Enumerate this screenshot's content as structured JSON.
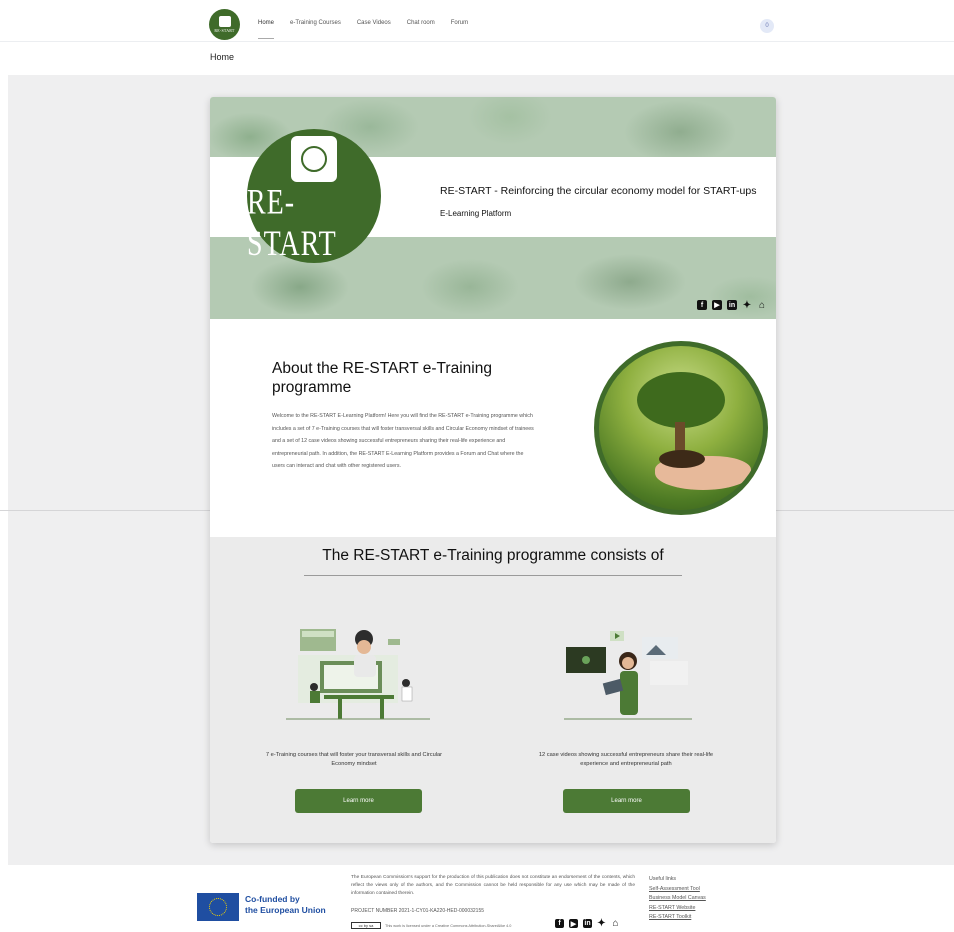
{
  "nav": {
    "brand_small": "RE-START",
    "items": [
      {
        "label": "Home",
        "active": true
      },
      {
        "label": "e-Training Courses",
        "active": false
      },
      {
        "label": "Case Videos",
        "active": false
      },
      {
        "label": "Chat room",
        "active": false
      },
      {
        "label": "Forum",
        "active": false
      }
    ],
    "user_initial": "0"
  },
  "breadcrumb": "Home",
  "hero": {
    "brand": "RE-START",
    "title": "RE-START - Reinforcing the circular economy model for START-ups",
    "subtitle": "E-Learning Platform",
    "socials": [
      "facebook-icon",
      "youtube-icon",
      "linkedin-icon",
      "twitter-icon",
      "home-icon"
    ]
  },
  "about": {
    "title": "About the RE-START e-Training programme",
    "text": "Welcome to the RE-START E-Learning Platform! Here you will find the RE-START e-Training programme which includes a set of 7 e-Training courses that will foster transversal skills and Circular Economy mindset of trainees and a set of 12 case videos showing successful entrepreneurs sharing their real-life experience and entrepreneurial path. In addition, the RE-START E-Learning Platform provides a Forum and Chat where the users can interact and chat with other registered users."
  },
  "consists": {
    "title": "The RE-START e-Training programme consists of",
    "columns": [
      {
        "text": "7 e-Training courses that will foster your transversal skills and Circular Economy mindset",
        "button": "Learn more"
      },
      {
        "text": "12 case videos showing successful entrepreneurs share their real-life experience and entrepreneurial path",
        "button": "Learn more"
      }
    ]
  },
  "footer": {
    "eu_line1": "Co-funded by",
    "eu_line2": "the European Union",
    "disclaimer": "The European Commission's support for the production of this publication does not constitute an endorsement of the contents, which reflect the views only of the authors, and the Commission cannot be held responsible for any use which may be made of the information contained therein.",
    "project_number": "PROJECT NUMBER 2021-1-CY01-KA220-HED-000032155",
    "cc_badge": "cc by sa",
    "license": "This work is licensed under a Creative Commons Attribution-ShareAlike 4.0",
    "useful_title": "Useful links",
    "useful_links": [
      "Self-Assessment Tool",
      "Business Model Canvas",
      "RE-START Website",
      "RE-START Toolkit"
    ]
  },
  "colors": {
    "brand_green": "#3f6b2a",
    "button_green": "#4c7a35",
    "eu_blue": "#1f4ea1"
  }
}
